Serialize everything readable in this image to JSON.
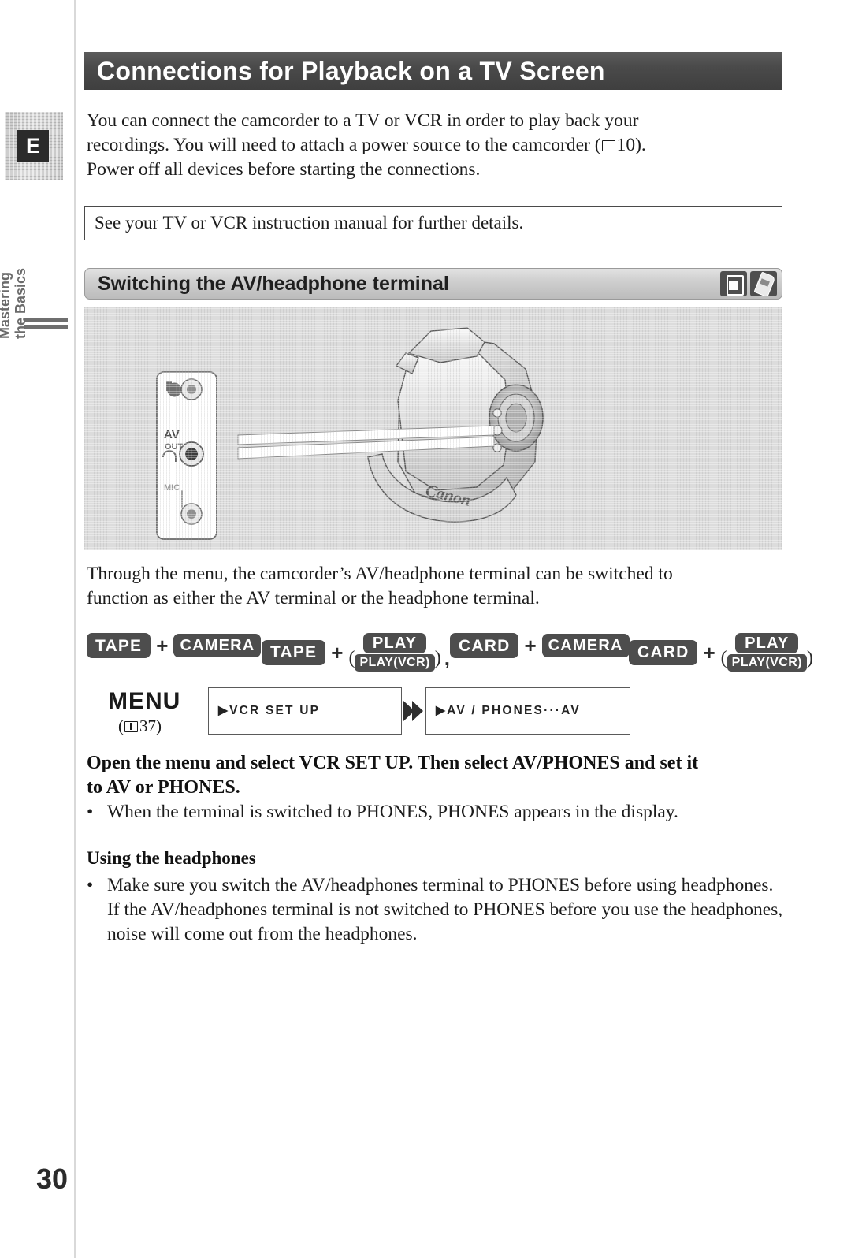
{
  "page": {
    "number": "30",
    "language_badge": "E",
    "side_tab_line1": "Mastering",
    "side_tab_line2": "the Basics"
  },
  "chapter": {
    "title": "Connections for Playback on a TV Screen"
  },
  "intro": {
    "line1": "You can connect the camcorder to a TV or VCR in order to play back your",
    "line2a": "recordings. You will need to attach a power source to the camcorder (",
    "ref_page": "10",
    "line2b": ").",
    "line3": "Power off all devices before starting the connections."
  },
  "note": {
    "text": "See your TV or VCR instruction manual for further details."
  },
  "section": {
    "title": "Switching the AV/headphone terminal",
    "icons": [
      "tape-icon",
      "card-icon"
    ]
  },
  "illustration": {
    "alt": "camcorder-with-terminal-panel-callout",
    "brand": "Canon",
    "terminal_labels": {
      "dv": "DV",
      "av_out": "AV",
      "av_out_sub": "OUT",
      "mic": "MIC"
    }
  },
  "through_menu": {
    "line1": "Through the menu, the camcorder’s AV/headphone terminal can be switched to",
    "line2": "function as either the AV terminal or the headphone terminal."
  },
  "modes": [
    {
      "primary": "TAPE",
      "secondary": "CAMERA",
      "paren": false
    },
    {
      "primary": "TAPE",
      "secondary": "PLAY",
      "secondary_alt": "PLAY(VCR)",
      "paren": true
    },
    {
      "primary": "CARD",
      "secondary": "CAMERA",
      "paren": false
    },
    {
      "primary": "CARD",
      "secondary": "PLAY",
      "secondary_alt": "PLAY(VCR)",
      "paren": true
    }
  ],
  "menu_flow": {
    "label": "MENU",
    "ref_open": "(",
    "ref_page": "37",
    "ref_close": ")",
    "step1": "▶VCR SET UP",
    "step2": "▶AV / PHONES···AV"
  },
  "instruction": {
    "line1": "Open the menu and select VCR SET UP. Then select AV/PHONES and set it",
    "line2": "to AV or PHONES."
  },
  "bullets": [
    {
      "text": "When the terminal is switched to PHONES, PHONES appears in the display."
    }
  ],
  "subsection": {
    "heading": "Using the headphones",
    "bullet": {
      "line1": "Make sure you switch the AV/headphones terminal to PHONES before using",
      "line2": "headphones. If the AV/headphones terminal is not switched to PHONES before",
      "line3": "you use the headphones, noise will come out from the headphones."
    }
  },
  "colors": {
    "chapter_bar": "#4a4a4a",
    "section_bar": "#cfcfcf",
    "badge": "#4d4d4d",
    "illustration_bg": "#dcdcdc"
  }
}
